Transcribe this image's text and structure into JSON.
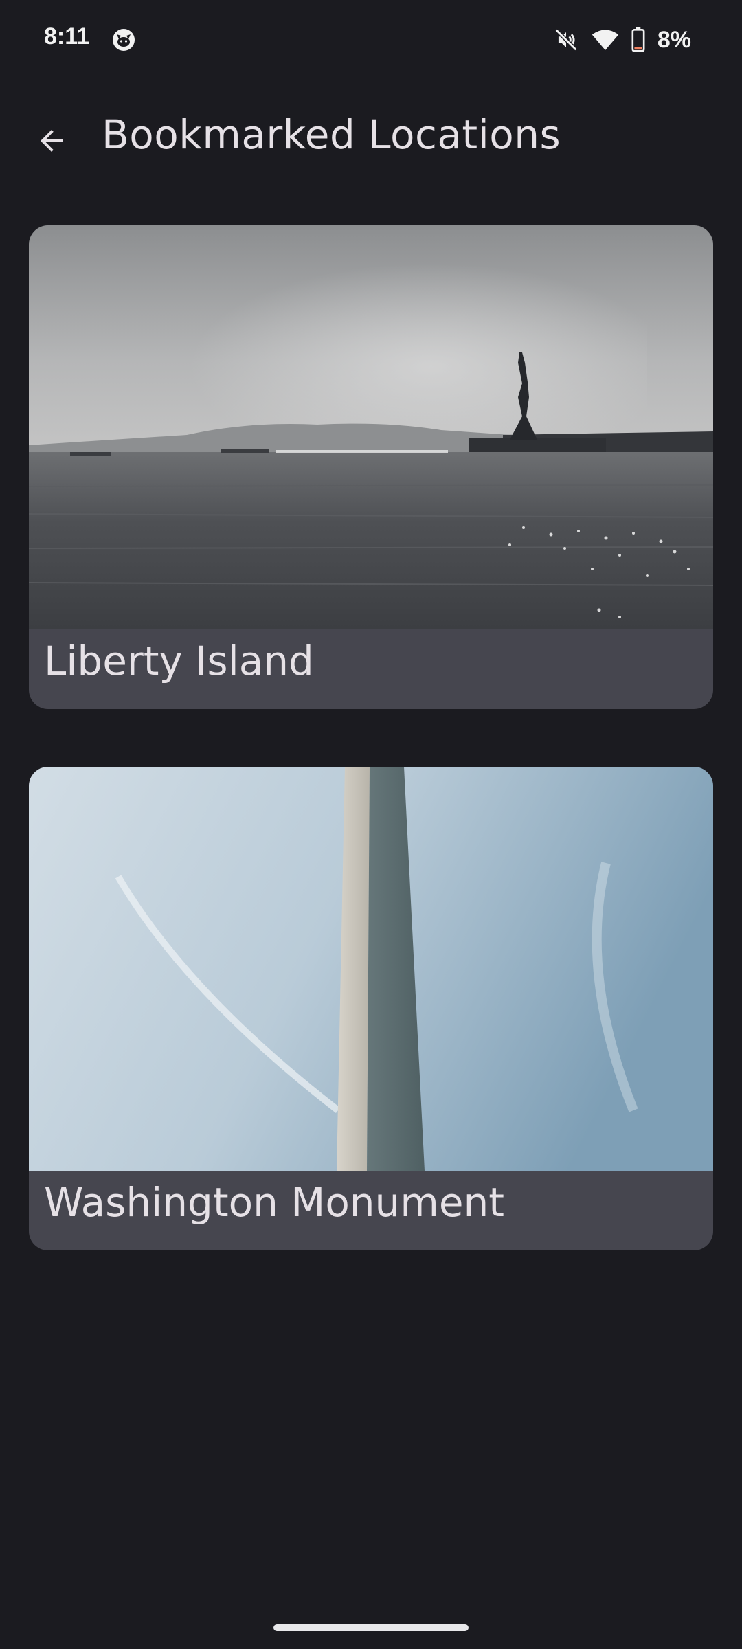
{
  "status_bar": {
    "time": "8:11",
    "battery_percent": "8%",
    "app_icon": "cat-face-icon",
    "icons": [
      "mute-icon",
      "wifi-icon",
      "battery-low-icon"
    ]
  },
  "app_bar": {
    "title": "Bookmarked Locations",
    "back_icon": "arrow-back-icon"
  },
  "locations": [
    {
      "name": "Liberty Island",
      "image_icon": "liberty-island-photo"
    },
    {
      "name": "Washington Monument",
      "image_icon": "washington-monument-photo"
    }
  ],
  "colors": {
    "background": "#1b1b20",
    "card": "#46464f",
    "text": "#e6e1e6"
  }
}
